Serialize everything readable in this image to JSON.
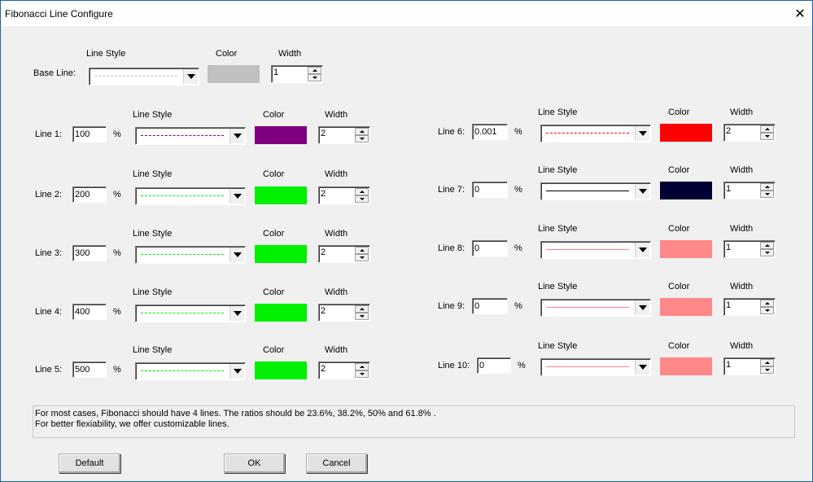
{
  "window": {
    "title": "Fibonacci Line Configure",
    "close_glyph": "✕"
  },
  "headers": {
    "line_style": "Line Style",
    "color": "Color",
    "width": "Width"
  },
  "base_line": {
    "label": "Base Line:",
    "style": "dashed",
    "line_color": "#c0c0c0",
    "swatch": "#c0c0c0",
    "width": "1"
  },
  "percent_sign": "%",
  "lines": [
    {
      "label": "Line 1:",
      "value": "100",
      "style": "dashed",
      "line_color": "#800080",
      "swatch": "#800080",
      "width": "2"
    },
    {
      "label": "Line 2:",
      "value": "200",
      "style": "dashed",
      "line_color": "#00ee00",
      "swatch": "#00f000",
      "width": "2"
    },
    {
      "label": "Line 3:",
      "value": "300",
      "style": "dashed",
      "line_color": "#00ee00",
      "swatch": "#00f000",
      "width": "2"
    },
    {
      "label": "Line 4:",
      "value": "400",
      "style": "dashed",
      "line_color": "#00ee00",
      "swatch": "#00f000",
      "width": "2"
    },
    {
      "label": "Line 5:",
      "value": "500",
      "style": "dashed",
      "line_color": "#00ee00",
      "swatch": "#00f000",
      "width": "2"
    },
    {
      "label": "Line 6:",
      "value": "0.001",
      "style": "dashed",
      "line_color": "#ff0000",
      "swatch": "#ff0000",
      "width": "2"
    },
    {
      "label": "Line 7:",
      "value": "0",
      "style": "solid",
      "line_color": "#000000",
      "swatch": "#000033",
      "width": "1"
    },
    {
      "label": "Line 8:",
      "value": "0",
      "style": "solid",
      "line_color": "#ff8080",
      "swatch": "#ff8888",
      "width": "1"
    },
    {
      "label": "Line 9:",
      "value": "0",
      "style": "solid",
      "line_color": "#ff8080",
      "swatch": "#ff8888",
      "width": "1"
    },
    {
      "label": "Line 10:",
      "value": "0",
      "style": "solid",
      "line_color": "#ff8080",
      "swatch": "#ff8888",
      "width": "1"
    }
  ],
  "info": {
    "line1": "For most cases, Fibonacci should have 4 lines. The ratios should be 23.6%, 38.2%,  50% and 61.8% .",
    "line2": "For better flexiability, we offer customizable lines."
  },
  "buttons": {
    "default": "Default",
    "ok": "OK",
    "cancel": "Cancel"
  }
}
